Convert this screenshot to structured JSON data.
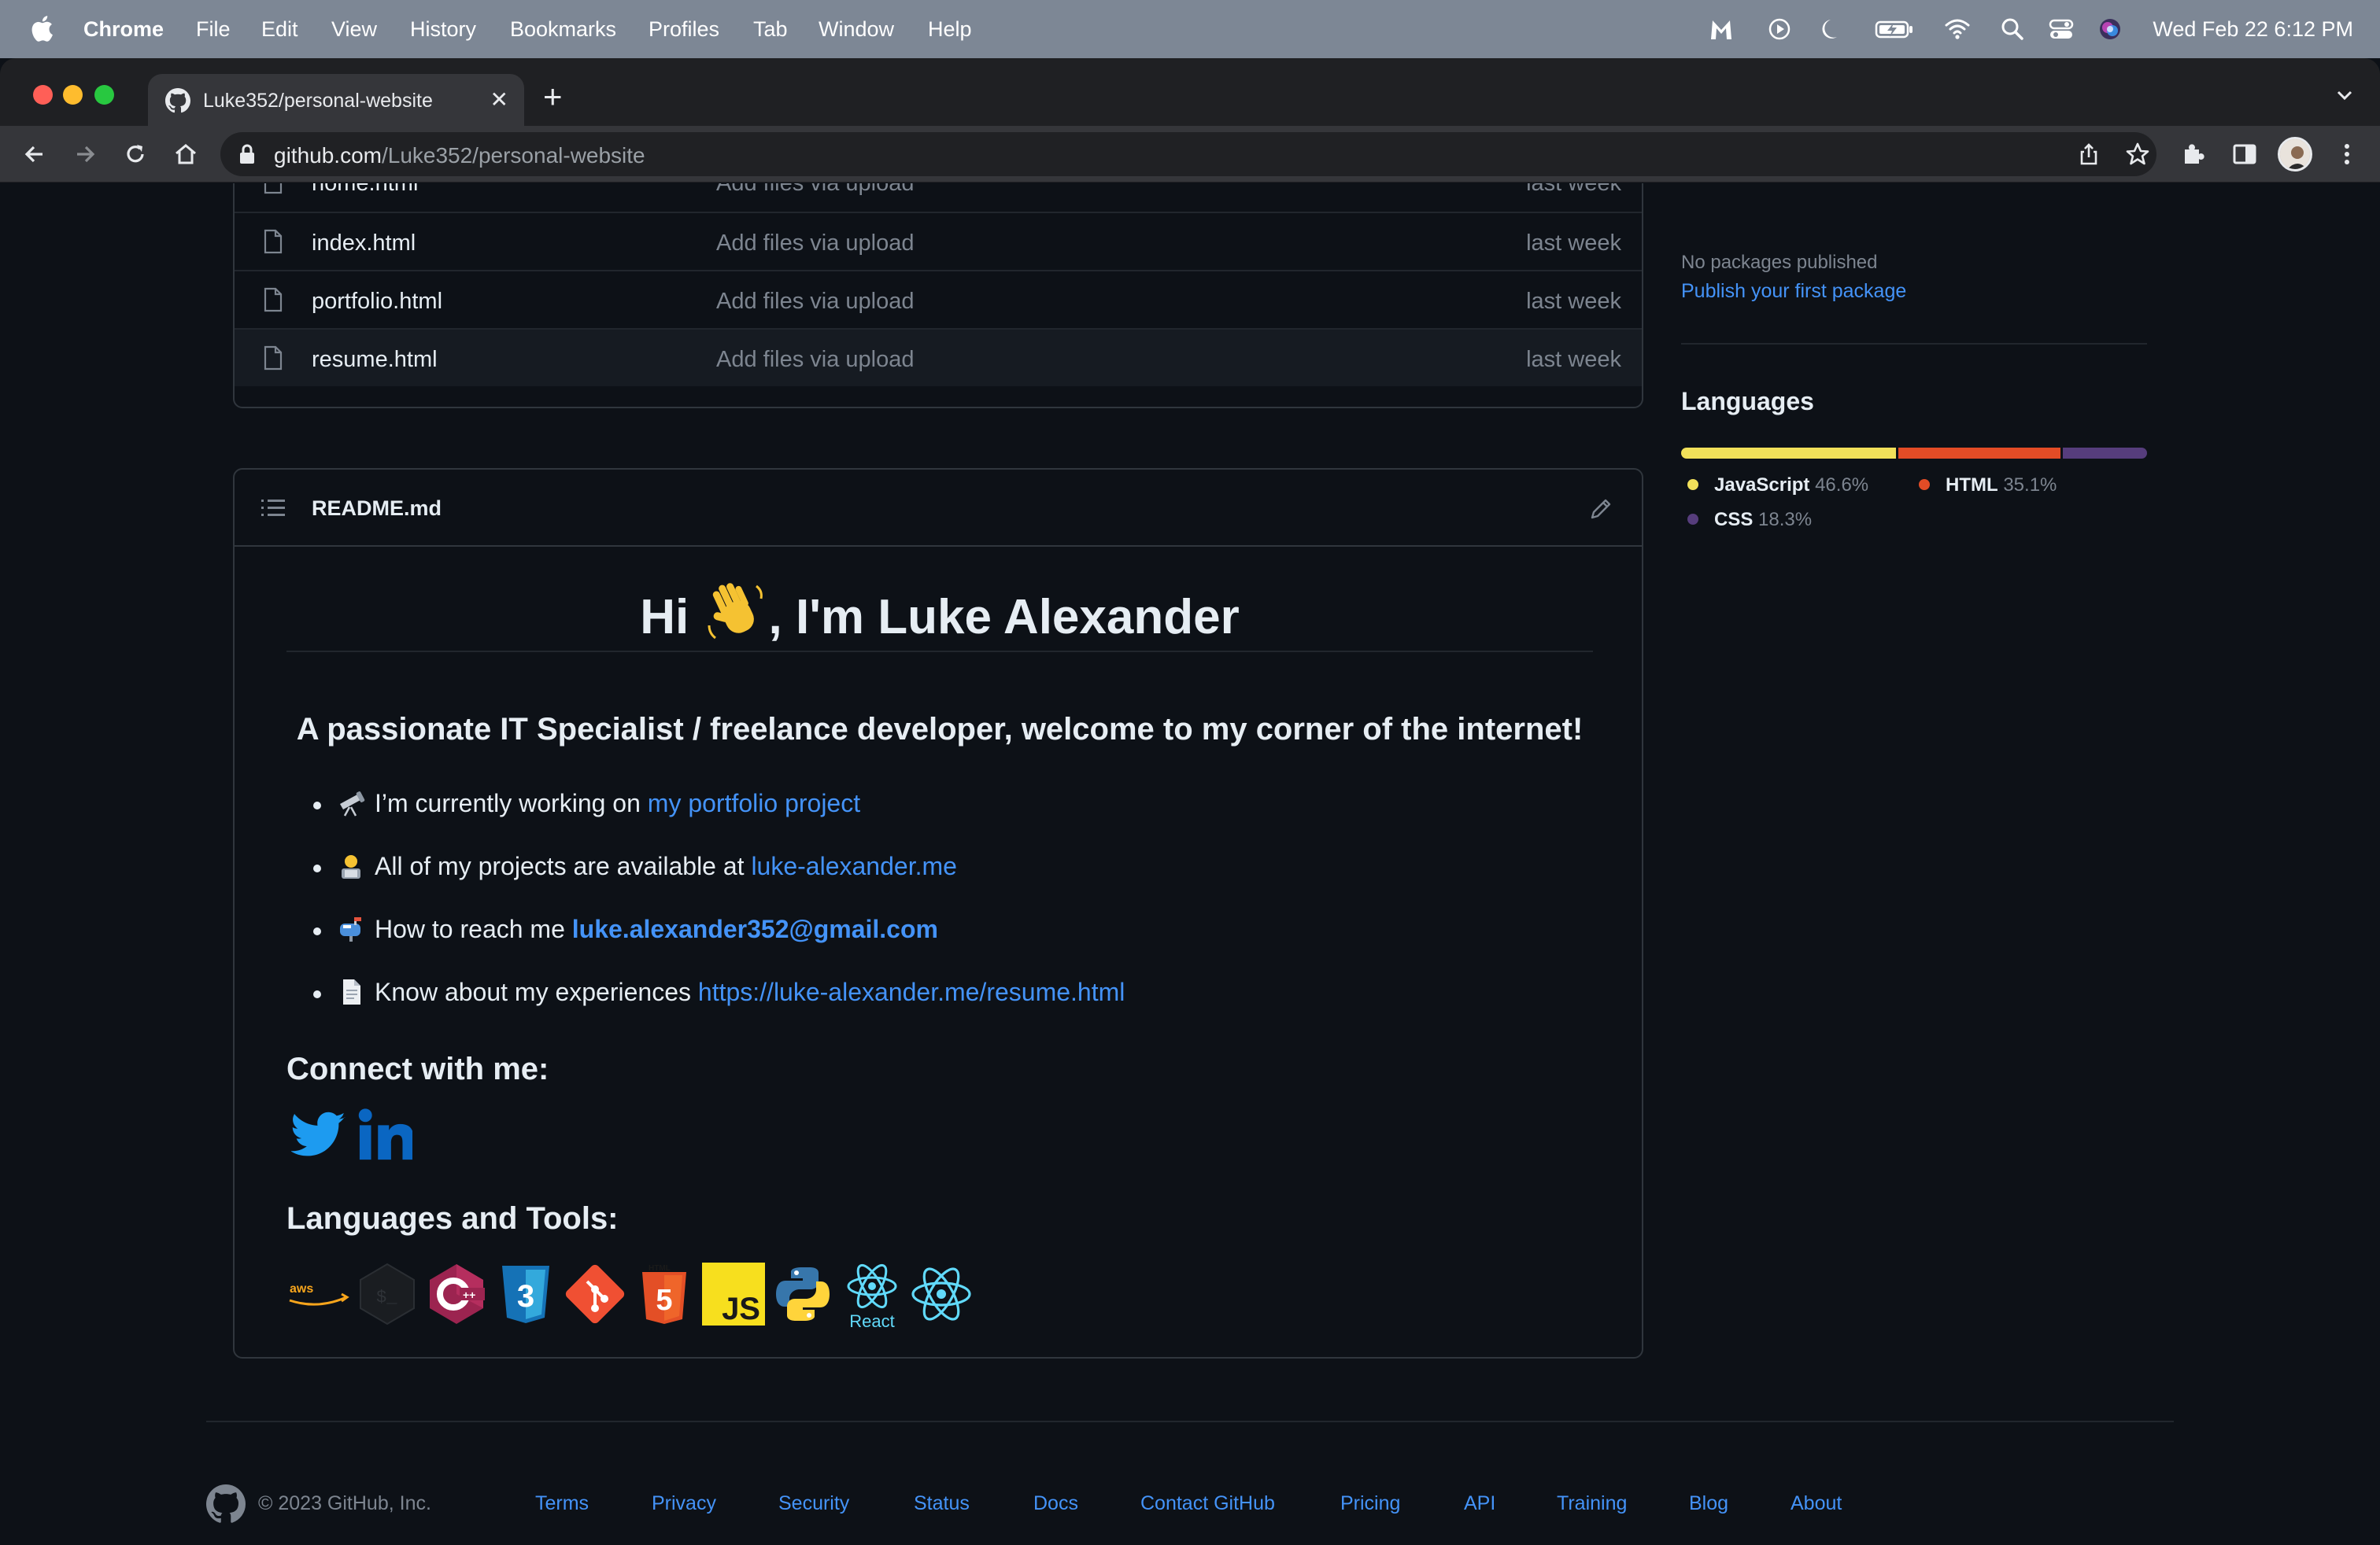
{
  "menubar": {
    "app": "Chrome",
    "items": [
      "File",
      "Edit",
      "View",
      "History",
      "Bookmarks",
      "Profiles",
      "Tab",
      "Window",
      "Help"
    ],
    "clock": "Wed Feb 22  6:12 PM"
  },
  "browser": {
    "tab_title": "Luke352/personal-website",
    "url_host": "github.com",
    "url_path": "/Luke352/personal-website",
    "traffic_colors": [
      "#ff5f57",
      "#febc2e",
      "#28c840"
    ]
  },
  "files": [
    {
      "name": "home.html",
      "message": "Add files via upload",
      "age": "last week"
    },
    {
      "name": "index.html",
      "message": "Add files via upload",
      "age": "last week"
    },
    {
      "name": "portfolio.html",
      "message": "Add files via upload",
      "age": "last week"
    },
    {
      "name": "resume.html",
      "message": "Add files via upload",
      "age": "last week"
    }
  ],
  "readme": {
    "filename": "README.md",
    "heading_pre": "Hi ",
    "heading_post": ", I'm Luke Alexander",
    "tagline": "A passionate IT Specialist / freelance developer, welcome to my corner of the internet!",
    "bullets": [
      {
        "text": "I’m currently working on ",
        "link": "my portfolio project",
        "bold": false
      },
      {
        "text": "All of my projects are available at ",
        "link": "luke-alexander.me",
        "bold": false
      },
      {
        "text": "How to reach me ",
        "link": "luke.alexander352@gmail.com",
        "bold": true
      },
      {
        "text": "Know about my experiences ",
        "link": "https://luke-alexander.me/resume.html",
        "bold": false
      }
    ],
    "connect_heading": "Connect with me:",
    "tools_heading": "Languages and Tools:",
    "react_label": "React",
    "tools": [
      "aws-icon",
      "bash-icon",
      "cplusplus-icon",
      "css3-icon",
      "git-icon",
      "html5-icon",
      "javascript-icon",
      "python-icon",
      "react-icon",
      "react-native-icon"
    ]
  },
  "sidebar": {
    "packages_text": "No packages published",
    "packages_link": "Publish your first package",
    "languages_heading": "Languages",
    "languages": [
      {
        "name": "JavaScript",
        "percent": "46.6%",
        "value": 46.6,
        "color": "#f1e05a"
      },
      {
        "name": "HTML",
        "percent": "35.1%",
        "value": 35.1,
        "color": "#e34c26"
      },
      {
        "name": "CSS",
        "percent": "18.3%",
        "value": 18.3,
        "color": "#563d7c"
      }
    ]
  },
  "footer": {
    "copyright": "© 2023 GitHub, Inc.",
    "links": [
      "Terms",
      "Privacy",
      "Security",
      "Status",
      "Docs",
      "Contact GitHub",
      "Pricing",
      "API",
      "Training",
      "Blog",
      "About"
    ]
  }
}
